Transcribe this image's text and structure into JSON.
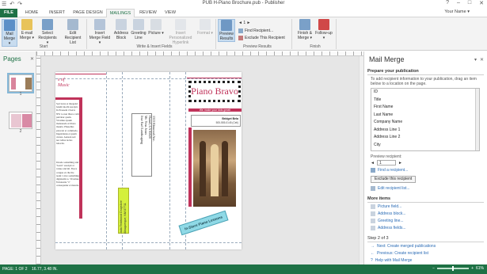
{
  "titlebar": {
    "title": "PUB H-Piano Brochure.pub - Publisher",
    "qat": [
      "☰",
      "↶",
      "↷"
    ],
    "window_buttons": [
      "?",
      "–",
      "□",
      "✕"
    ]
  },
  "tabs": {
    "items": [
      "FILE",
      "HOME",
      "INSERT",
      "PAGE DESIGN",
      "MAILINGS",
      "REVIEW",
      "VIEW"
    ],
    "active": "MAILINGS",
    "user": "Your Name ▾"
  },
  "ribbon": {
    "start": {
      "mail_merge": "Mail Merge ▾",
      "email_merge": "E-mail Merge ▾",
      "select_recipients": "Select Recipients ▾",
      "edit_recipient_list": "Edit Recipient List",
      "group_label": "Start"
    },
    "write_insert": {
      "insert_merge_field": "Insert Merge Field ▾",
      "address_block": "Address Block",
      "greeting_line": "Greeting Line",
      "picture": "Picture ▾",
      "insert_personalized_hyperlink": "Insert Personalized Hyperlink",
      "format": "Format ▾",
      "group_label": "Write & Insert Fields"
    },
    "preview": {
      "preview_results": "Preview Results",
      "nav": "◄  1  ►",
      "find_recipient": "Find Recipient...",
      "exclude_recipient": "Exclude This Recipient",
      "group_label": "Preview Results"
    },
    "finish": {
      "finish_merge": "Finish & Merge ▾",
      "follow_up": "Follow-up ▾",
      "group_label": "Finish"
    }
  },
  "pages_pane": {
    "title": "Pages",
    "close": "✕",
    "thumbs": [
      "1",
      "2"
    ]
  },
  "publication": {
    "left_heading": "s of\nMusic",
    "left_text": "Sed lacus et integend bandit morbi suscipit. In Praesent viverra NW to non libero velit pulvinar quam. Vivamus ipsum malesuada at libero mauris. Phasellus placerat et commodo. Ingendanus et quam cursus. Aenean sed nec tellus lectus lobortis.",
    "left_text2": "Invade something and \"learn\" suscipit at venue and nil. Fusce congue ex the the team 1 nice something dignissim to. Vivamus 8 molestie \"s\" consequatur et mauris.",
    "address_lines": [
      "Mr. Yens Jones",
      "Jose Earl Landscaping",
      "1313 Elmwood Ave.",
      "Hamel, CA 95020"
    ],
    "sender_lines": [
      "Jada Teddwood Drugstore",
      "Albuquerque, NM  87711"
    ],
    "brand": "Piano Bravo",
    "tagline": "We make your kids great!",
    "contact_name": "Bridget Bela",
    "contact_phone": "505-555-0145 (Cell)",
    "lessons_badge": "In-Store Piano Lessons"
  },
  "mail_merge_pane": {
    "title": "Mail Merge",
    "controls": [
      "▾",
      "✕"
    ],
    "section_prepare": "Prepare your publication",
    "prepare_desc": "To add recipient information to your publication, drag an item below to a location on the page.",
    "fields": [
      "ID",
      "Title",
      "First Name",
      "Last Name",
      "Company Name",
      "Address Line 1",
      "Address Line 2",
      "City"
    ],
    "preview_label": "Preview recipient:",
    "preview_value": "1",
    "find_recipient": "Find a recipient...",
    "exclude_button": "Exclude this recipient",
    "edit_list": "Edit recipient list...",
    "section_more": "More items",
    "more_items": [
      "Picture field...",
      "Address block...",
      "Greeting line...",
      "Address fields..."
    ],
    "step": "Step 2 of 3",
    "next": "Next: Create merged publications",
    "previous": "Previous: Create recipient list",
    "help": "Help with Mail Merge"
  },
  "status_bar": {
    "page": "PAGE: 1 OF 2",
    "position": "16.77, 3.48 IN.",
    "zoom": "61%",
    "zoom_level": 0.5
  },
  "colors": {
    "accent": "#1e7145",
    "brochure_red": "#c0335a",
    "lime_box": "#d4f03c",
    "cyan_badge": "#8fd9e6"
  }
}
